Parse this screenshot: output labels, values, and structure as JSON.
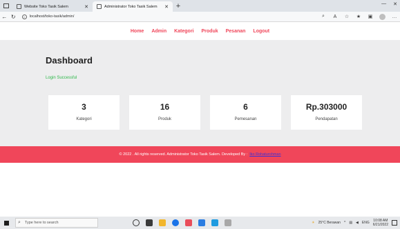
{
  "browser": {
    "tabs": [
      {
        "title": "Website Toko Tasik Salem",
        "active": false
      },
      {
        "title": "Administrator Toko Tasik Salem",
        "active": true
      }
    ],
    "new_tab": "+",
    "address": "localhost/toko-tasik/admin/",
    "controls": {
      "minimize": "—",
      "close": "✕"
    }
  },
  "nav": {
    "items": [
      "Home",
      "Admin",
      "Kategori",
      "Produk",
      "Pesanan",
      "Logout"
    ]
  },
  "dashboard": {
    "title": "Dashboard",
    "message": "Login Successful",
    "cards": [
      {
        "value": "3",
        "label": "Kategori"
      },
      {
        "value": "16",
        "label": "Produk"
      },
      {
        "value": "6",
        "label": "Pemesanan"
      },
      {
        "value": "Rp.303000",
        "label": "Pendapatan"
      }
    ]
  },
  "footer": {
    "text": "© 2022 . All rights reserved. Administrator Toko Tasik Salem. Developed By :",
    "developer": "Iko Rohaturohman"
  },
  "taskbar": {
    "search_placeholder": "Type here to search",
    "weather": "25°C Berawan",
    "lang": "ENG",
    "time": "10:08 AM",
    "date": "6/21/2022"
  },
  "colors": {
    "accent": "#f0465a",
    "success": "#2eb84a",
    "developer_link": "#3b2fd6"
  }
}
